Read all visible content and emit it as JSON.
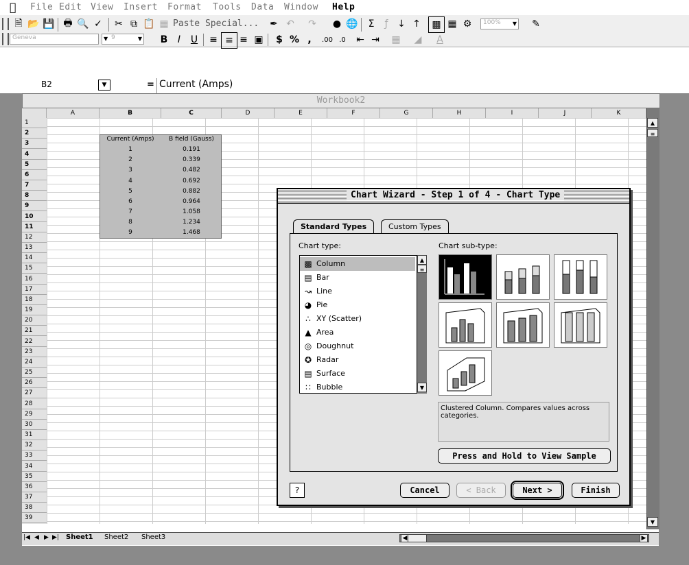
{
  "menubar": {
    "items": [
      "File",
      "Edit",
      "View",
      "Insert",
      "Format",
      "Tools",
      "Data",
      "Window",
      "Help"
    ]
  },
  "toolbar": {
    "paste_special": "Paste Special...",
    "zoom": "100%",
    "font": "Geneva",
    "font_size": "9"
  },
  "formula_bar": {
    "name_box": "B2",
    "equals": "=",
    "value": "Current (Amps)"
  },
  "workbook": {
    "title": "Workbook2",
    "columns": [
      "A",
      "B",
      "C",
      "D",
      "E",
      "F",
      "G",
      "H",
      "I",
      "J",
      "K"
    ],
    "rows": [
      "1",
      "2",
      "3",
      "4",
      "5",
      "6",
      "7",
      "8",
      "9",
      "10",
      "11",
      "12",
      "13",
      "14",
      "15",
      "16",
      "17",
      "18",
      "19",
      "20",
      "21",
      "22",
      "23",
      "24",
      "25",
      "26",
      "27",
      "28",
      "29",
      "30",
      "31",
      "32",
      "33",
      "34",
      "35",
      "36",
      "37",
      "38",
      "39"
    ],
    "headers": [
      "Current (Amps)",
      "B field (Gauss)"
    ],
    "table": [
      [
        "1",
        "0.191"
      ],
      [
        "2",
        "0.339"
      ],
      [
        "3",
        "0.482"
      ],
      [
        "4",
        "0.692"
      ],
      [
        "5",
        "0.882"
      ],
      [
        "6",
        "0.964"
      ],
      [
        "7",
        "1.058"
      ],
      [
        "8",
        "1.234"
      ],
      [
        "9",
        "1.468"
      ]
    ],
    "sheets": [
      "Sheet1",
      "Sheet2",
      "Sheet3"
    ]
  },
  "dialog": {
    "title": "Chart Wizard - Step 1 of 4 - Chart Type",
    "tabs": [
      "Standard Types",
      "Custom Types"
    ],
    "chart_type_label": "Chart type:",
    "subtype_label": "Chart sub-type:",
    "chart_types": [
      "Column",
      "Bar",
      "Line",
      "Pie",
      "XY (Scatter)",
      "Area",
      "Doughnut",
      "Radar",
      "Surface",
      "Bubble"
    ],
    "description": "Clustered Column. Compares values across categories.",
    "sample_button": "Press and Hold to View Sample",
    "help_button": "?",
    "cancel": "Cancel",
    "back": "< Back",
    "next": "Next >",
    "finish": "Finish"
  }
}
